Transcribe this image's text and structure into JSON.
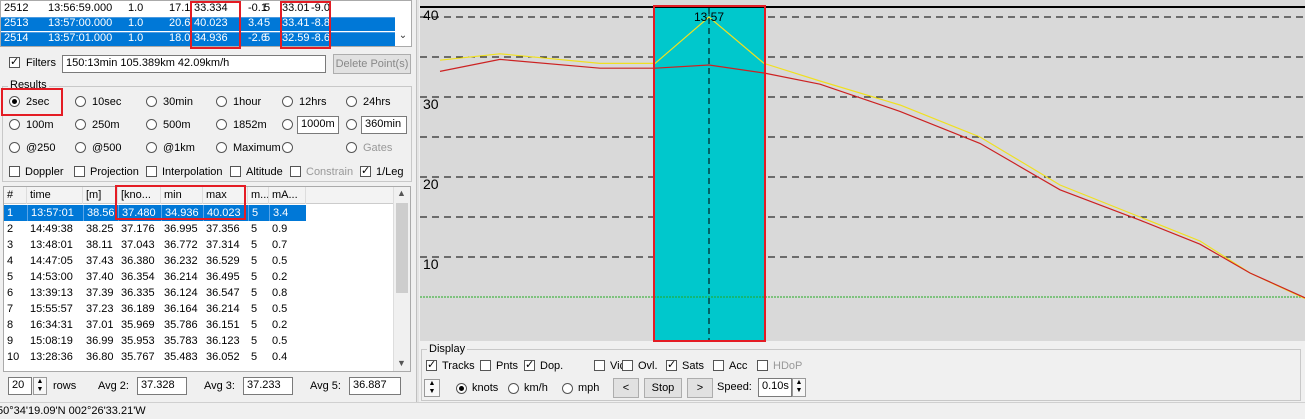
{
  "top_rows": [
    {
      "id": "2512",
      "time": "13:56:59.000",
      "a": "1.0",
      "b": "17.1",
      "c": "33.334",
      "d": "-0.1",
      "e": "5",
      "f": "33.01",
      "g": "-9.0",
      "selected": false
    },
    {
      "id": "2513",
      "time": "13:57:00.000",
      "a": "1.0",
      "b": "20.6",
      "c": "40.023",
      "d": "3.4",
      "e": "5",
      "f": "33.41",
      "g": "-8.8",
      "selected": true
    },
    {
      "id": "2514",
      "time": "13:57:01.000",
      "a": "1.0",
      "b": "18.0",
      "c": "34.936",
      "d": "-2.6",
      "e": "5",
      "f": "32.59",
      "g": "-8.6",
      "selected": true
    }
  ],
  "filters": {
    "label": "Filters",
    "value": "150:13min 105.389km 42.09km/h",
    "delete_label": "Delete Point(s)"
  },
  "results": {
    "group_label": "Results",
    "radios": [
      {
        "label": "2sec",
        "on": true
      },
      {
        "label": "10sec",
        "on": false
      },
      {
        "label": "30min",
        "on": false
      },
      {
        "label": "1hour",
        "on": false
      },
      {
        "label": "12hrs",
        "on": false
      },
      {
        "label": "24hrs",
        "on": false
      },
      {
        "label": "100m",
        "on": false
      },
      {
        "label": "250m",
        "on": false
      },
      {
        "label": "500m",
        "on": false
      },
      {
        "label": "1852m",
        "on": false
      },
      {
        "label": "1000m",
        "on": false,
        "input": true
      },
      {
        "label": "360min",
        "on": false,
        "input": true
      },
      {
        "label": "@250",
        "on": false
      },
      {
        "label": "@500",
        "on": false
      },
      {
        "label": "@1km",
        "on": false
      },
      {
        "label": "Maximum",
        "on": false
      },
      {
        "label": "",
        "on": false
      },
      {
        "label": "Gates",
        "on": false,
        "disabled": true
      }
    ],
    "checks": [
      {
        "label": "Doppler",
        "on": false
      },
      {
        "label": "Projection",
        "on": false
      },
      {
        "label": "Interpolation",
        "on": false
      },
      {
        "label": "Altitude",
        "on": false
      },
      {
        "label": "Constrain",
        "on": false,
        "disabled": true
      },
      {
        "label": "1/Leg",
        "on": true
      }
    ]
  },
  "table": {
    "headers": [
      "#",
      "time",
      "[m]",
      "[kno...",
      "min",
      "max",
      "m...",
      "mA..."
    ],
    "rows": [
      [
        "1",
        "13:57:01",
        "38.56",
        "37.480",
        "34.936",
        "40.023",
        "5",
        "3.4"
      ],
      [
        "2",
        "14:49:38",
        "38.25",
        "37.176",
        "36.995",
        "37.356",
        "5",
        "0.9"
      ],
      [
        "3",
        "13:48:01",
        "38.11",
        "37.043",
        "36.772",
        "37.314",
        "5",
        "0.7"
      ],
      [
        "4",
        "14:47:05",
        "37.43",
        "36.380",
        "36.232",
        "36.529",
        "5",
        "0.5"
      ],
      [
        "5",
        "14:53:00",
        "37.40",
        "36.354",
        "36.214",
        "36.495",
        "5",
        "0.2"
      ],
      [
        "6",
        "13:39:13",
        "37.39",
        "36.335",
        "36.124",
        "36.547",
        "5",
        "0.8"
      ],
      [
        "7",
        "15:55:57",
        "37.23",
        "36.189",
        "36.164",
        "36.214",
        "5",
        "0.5"
      ],
      [
        "8",
        "16:34:31",
        "37.01",
        "35.969",
        "35.786",
        "36.151",
        "5",
        "0.2"
      ],
      [
        "9",
        "15:08:19",
        "36.99",
        "35.953",
        "35.783",
        "36.123",
        "5",
        "0.5"
      ],
      [
        "10",
        "13:28:36",
        "36.80",
        "35.767",
        "35.483",
        "36.052",
        "5",
        "0.4"
      ]
    ]
  },
  "footer": {
    "rows_value": "20",
    "rows_label": "rows",
    "avg2_label": "Avg 2:",
    "avg2": "37.328",
    "avg3_label": "Avg 3:",
    "avg3": "37.233",
    "avg5_label": "Avg 5:",
    "avg5": "36.887"
  },
  "status": {
    "coords": "50°34'19.09'N 002°26'33.21'W"
  },
  "graph": {
    "y_ticks": [
      "40",
      "30",
      "20",
      "10"
    ],
    "cursor_label": "13:57",
    "colors": {
      "bg": "#d9d9d9",
      "highlight": "#00c8cc",
      "red": "#cc2222",
      "yellow": "#f0e020",
      "green": "#22aa22"
    }
  },
  "display": {
    "group_label": "Display",
    "checks": [
      {
        "label": "Tracks",
        "on": true
      },
      {
        "label": "Pnts",
        "on": false
      },
      {
        "label": "Dop.",
        "on": true
      },
      {
        "label": "Vic.",
        "on": false
      },
      {
        "label": "Ovl.",
        "on": false
      },
      {
        "label": "Sats",
        "on": true
      },
      {
        "label": "Acc",
        "on": false
      },
      {
        "label": "HDoP",
        "on": false,
        "disabled": true
      }
    ],
    "units": [
      {
        "label": "knots",
        "on": true
      },
      {
        "label": "km/h",
        "on": false
      },
      {
        "label": "mph",
        "on": false
      }
    ],
    "prev_label": "<",
    "stop_label": "Stop",
    "next_label": ">",
    "speed_label": "Speed:",
    "speed_value": "0.10s"
  }
}
